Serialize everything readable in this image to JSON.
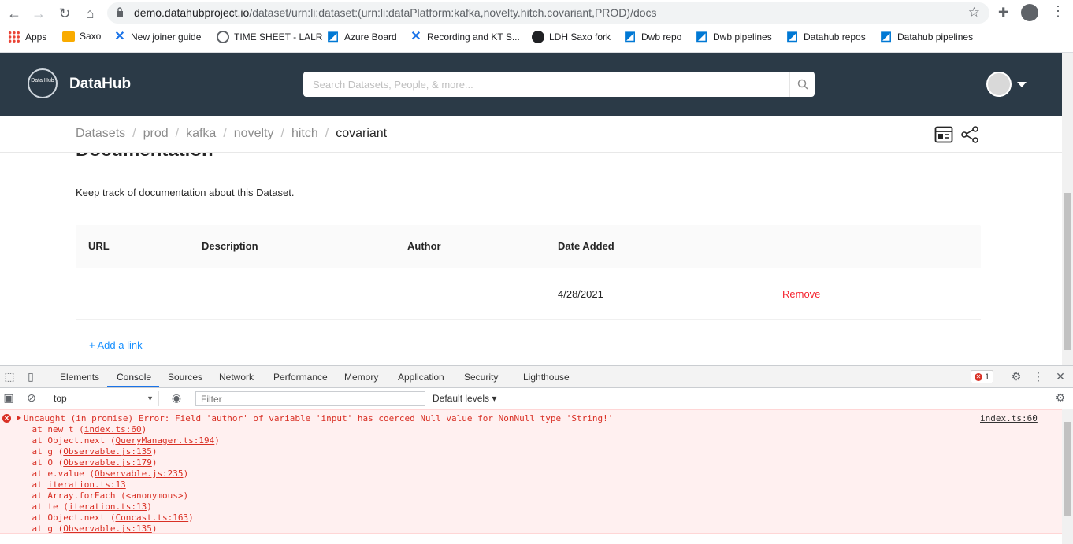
{
  "browser": {
    "url_host": "demo.datahubproject.io",
    "url_path": "/dataset/urn:li:dataset:(urn:li:dataPlatform:kafka,novelty.hitch.covariant,PROD)/docs",
    "bookmarks": [
      "Apps",
      "Saxo",
      "New joiner guide",
      "TIME SHEET - LALR",
      "Azure Board",
      "Recording and KT S...",
      "LDH Saxo fork",
      "Dwb repo",
      "Dwb pipelines",
      "Datahub repos",
      "Datahub pipelines"
    ]
  },
  "header": {
    "logo_text": "Data Hub",
    "title": "DataHub",
    "search_placeholder": "Search Datasets, People, & more..."
  },
  "breadcrumb": {
    "items": [
      "Datasets",
      "prod",
      "kafka",
      "novelty",
      "hitch"
    ],
    "separator": "/",
    "current": "covariant"
  },
  "docs": {
    "title": "Documentation",
    "description": "Keep track of documentation about this Dataset.",
    "columns": [
      "URL",
      "Description",
      "Author",
      "Date Added"
    ],
    "rows": [
      {
        "url": "",
        "description": "",
        "author": "",
        "date_added": "4/28/2021",
        "action": "Remove"
      }
    ],
    "add_link": "+ Add a link"
  },
  "devtools": {
    "tabs": [
      "Elements",
      "Console",
      "Sources",
      "Network",
      "Performance",
      "Memory",
      "Application",
      "Security",
      "Lighthouse"
    ],
    "active_tab": "Console",
    "error_count": "1",
    "context": "top",
    "filter_placeholder": "Filter",
    "levels": "Default levels ▾",
    "error": {
      "message": "Uncaught (in promise) Error: Field 'author' of variable 'input' has coerced Null value for NonNull type 'String!'",
      "source": "index.ts:60",
      "stack": [
        {
          "pre": "    at new t (",
          "link": "index.ts:60",
          "post": ")"
        },
        {
          "pre": "    at Object.next (",
          "link": "QueryManager.ts:194",
          "post": ")"
        },
        {
          "pre": "    at g (",
          "link": "Observable.js:135",
          "post": ")"
        },
        {
          "pre": "    at O (",
          "link": "Observable.js:179",
          "post": ")"
        },
        {
          "pre": "    at e.value (",
          "link": "Observable.js:235",
          "post": ")"
        },
        {
          "pre": "    at ",
          "link": "iteration.ts:13",
          "post": ""
        },
        {
          "pre": "    at Array.forEach (<anonymous>)",
          "link": "",
          "post": ""
        },
        {
          "pre": "    at te (",
          "link": "iteration.ts:13",
          "post": ")"
        },
        {
          "pre": "    at Object.next (",
          "link": "Concast.ts:163",
          "post": ")"
        },
        {
          "pre": "    at g (",
          "link": "Observable.js:135",
          "post": ")"
        }
      ]
    }
  },
  "colors": {
    "header_bg": "#2b3a47",
    "link_blue": "#1890ff",
    "danger_red": "#f5222d",
    "console_error": "#d93025"
  }
}
